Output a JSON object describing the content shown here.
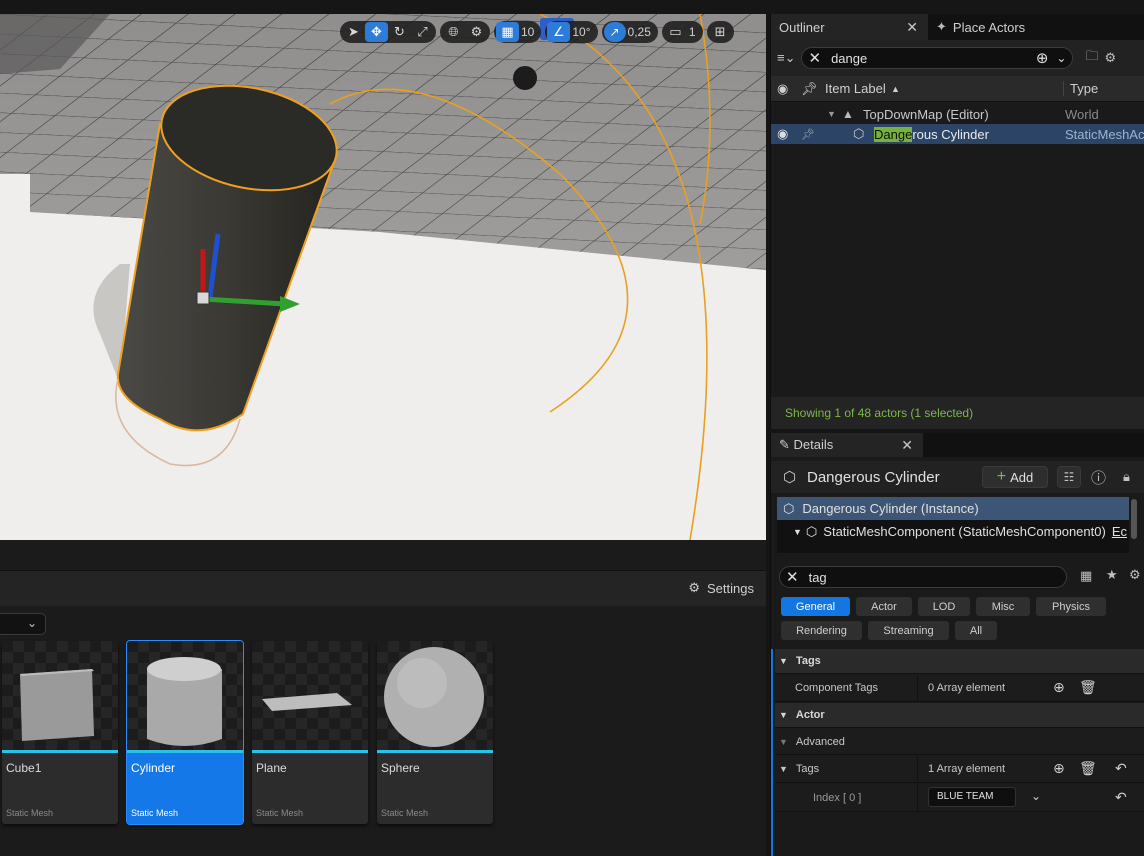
{
  "viewport": {
    "toolbar": {
      "select_icon": "arrow-cursor",
      "translate_icon": "move-arrows",
      "rotate_icon": "rotate",
      "scale_icon": "scale",
      "world_icon": "globe",
      "surface_snap_icon": "surface-snap",
      "grid_snap_value": "10",
      "rotation_snap_value": "10°",
      "scale_snap_value": "0,25",
      "camera_speed_value": "1",
      "layout_icon": "viewport-layout"
    }
  },
  "content_browser": {
    "settings_label": "Settings",
    "assets": [
      {
        "name": "Cube1",
        "type": "Static Mesh",
        "selected": false
      },
      {
        "name": "Cylinder",
        "type": "Static Mesh",
        "selected": true
      },
      {
        "name": "Plane",
        "type": "Static Mesh",
        "selected": false
      },
      {
        "name": "Sphere",
        "type": "Static Mesh",
        "selected": false
      }
    ]
  },
  "outliner": {
    "tabs": [
      {
        "label": "Outliner",
        "active": true
      },
      {
        "label": "Place Actors",
        "active": false
      }
    ],
    "search_value": "dange",
    "columns": {
      "item_label": "Item Label",
      "type": "Type"
    },
    "rows": [
      {
        "label": "TopDownMap (Editor)",
        "type": "World"
      },
      {
        "label_highlight": "Dange",
        "label_rest": "rous Cylinder",
        "type": "StaticMeshAc"
      }
    ],
    "footer": "Showing 1 of 48 actors (1 selected)"
  },
  "details": {
    "tab_label": "Details",
    "actor_name": "Dangerous Cylinder",
    "add_label": "Add",
    "components": [
      {
        "label": "Dangerous Cylinder (Instance)"
      },
      {
        "label": "StaticMeshComponent (StaticMeshComponent0)",
        "suffix": "Ec"
      }
    ],
    "search_value": "tag",
    "filters_row1": [
      "General",
      "Actor",
      "LOD",
      "Misc",
      "Physics"
    ],
    "filters_row2": [
      "Rendering",
      "Streaming",
      "All"
    ],
    "active_filter": "General",
    "sections": {
      "tags_header": "Tags",
      "component_tags_label": "Component Tags",
      "component_tags_value": "0 Array element",
      "actor_header": "Actor",
      "advanced_label": "Advanced",
      "actor_tags_label": "Tags",
      "actor_tags_value": "1 Array element",
      "index_label": "Index [ 0 ]",
      "index_value": "BLUE TEAM"
    }
  },
  "colors": {
    "accent_blue": "#1476e0",
    "selection_orange": "#f0a020",
    "outliner_green": "#7bb84a",
    "tile_underline": "#27c3e9"
  }
}
